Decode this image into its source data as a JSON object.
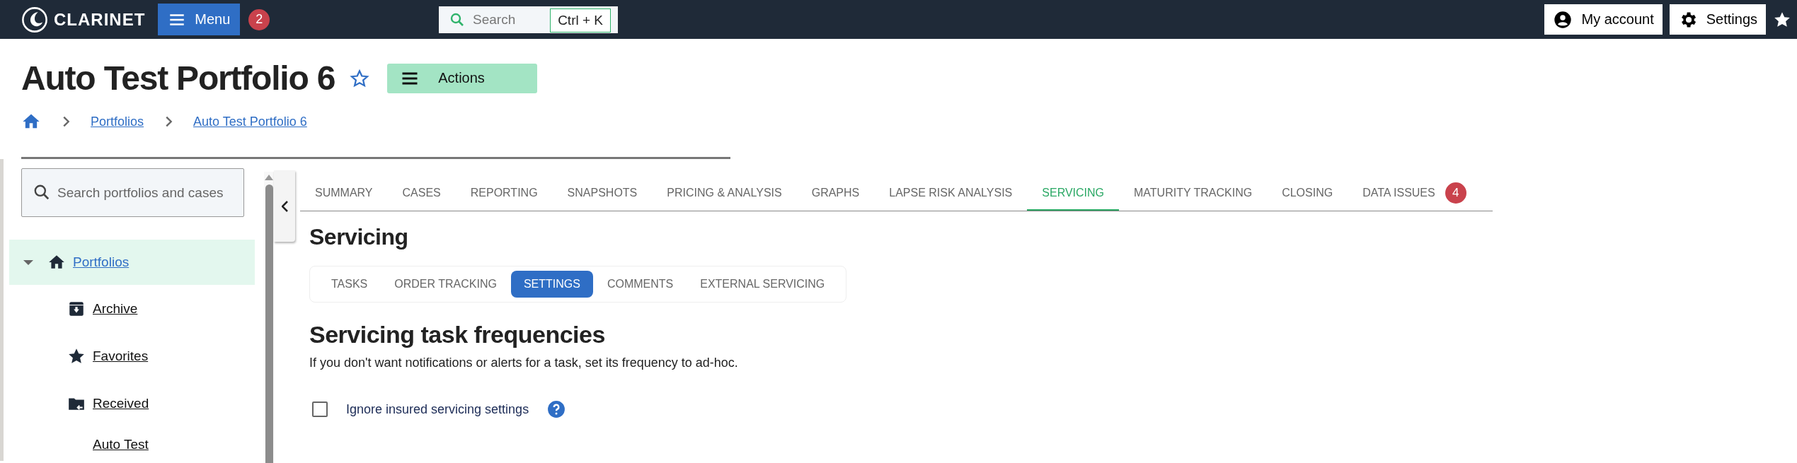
{
  "top_bar": {
    "logo_text": "CLARINET",
    "menu_button": {
      "label": "Menu",
      "badge": "2"
    },
    "search": {
      "placeholder": "Search",
      "shortcut": "Ctrl + K"
    },
    "account_button": "My account",
    "settings_button": "Settings"
  },
  "header": {
    "title": "Auto Test Portfolio 6",
    "favorite": false,
    "actions_button": "Actions",
    "breadcrumbs": [
      "Portfolios",
      "Auto Test Portfolio 6"
    ]
  },
  "sidebar": {
    "search": {
      "placeholder": "Search portfolios and cases"
    },
    "tree": [
      {
        "label": "Portfolios",
        "kind": "home",
        "expanded": true,
        "selected": true,
        "children": [
          {
            "label": "Archive",
            "kind": "archive",
            "selected": false
          },
          {
            "label": "Favorites",
            "kind": "favorites",
            "selected": false
          },
          {
            "label": "Received",
            "kind": "received",
            "selected": false
          },
          {
            "label": "Auto Test",
            "kind": "portfolio",
            "selected": false
          }
        ]
      }
    ]
  },
  "tabs": [
    {
      "label": "SUMMARY",
      "selected": false
    },
    {
      "label": "CASES",
      "selected": false
    },
    {
      "label": "REPORTING",
      "selected": false
    },
    {
      "label": "SNAPSHOTS",
      "selected": false
    },
    {
      "label": "PRICING & ANALYSIS",
      "selected": false
    },
    {
      "label": "GRAPHS",
      "selected": false
    },
    {
      "label": "LAPSE RISK ANALYSIS",
      "selected": false
    },
    {
      "label": "SERVICING",
      "selected": true
    },
    {
      "label": "MATURITY TRACKING",
      "selected": false
    },
    {
      "label": "CLOSING",
      "selected": false
    },
    {
      "label": "DATA ISSUES",
      "selected": false,
      "badge": "4"
    }
  ],
  "section_title": "Servicing",
  "subtabs": [
    {
      "label": "TASKS",
      "selected": false
    },
    {
      "label": "ORDER TRACKING",
      "selected": false
    },
    {
      "label": "SETTINGS",
      "selected": true
    },
    {
      "label": "COMMENTS",
      "selected": false
    },
    {
      "label": "EXTERNAL SERVICING",
      "selected": false
    }
  ],
  "settings": {
    "heading": "Servicing task frequencies",
    "description": "If you don't want notifications or alerts for a task, set its frequency to ad-hoc.",
    "ignore_checkbox": {
      "label": "Ignore insured servicing settings",
      "checked": false
    }
  }
}
